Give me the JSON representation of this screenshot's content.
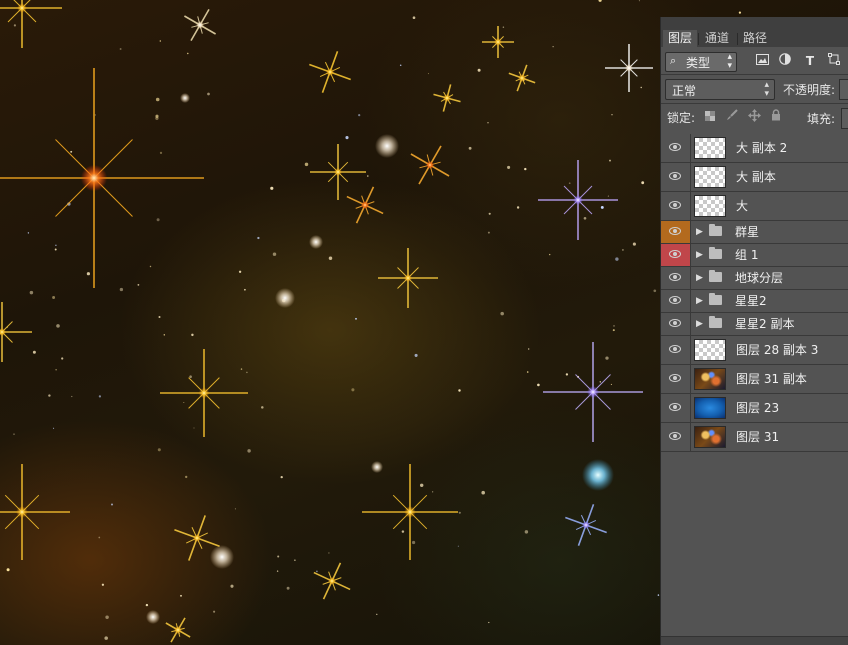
{
  "panel": {
    "tabs": [
      {
        "label": "图层",
        "active": true
      },
      {
        "label": "通道",
        "active": false
      },
      {
        "label": "路径",
        "active": false
      }
    ],
    "filter": {
      "label": "类型",
      "search_icon": "search-icon",
      "arrows_icon": "up-down-arrows-icon"
    },
    "filter_icons": [
      "image-filter-icon",
      "adjustment-filter-icon",
      "text-filter-icon",
      "shape-filter-icon"
    ],
    "text_filter_glyph": "T",
    "blend_mode": "正常",
    "opacity_label": "不透明度:",
    "lock_label": "锁定:",
    "fill_label": "填充:",
    "lock_icons": [
      "lock-transparent-icon",
      "lock-brush-icon",
      "lock-move-icon",
      "lock-all-icon"
    ]
  },
  "layers": [
    {
      "name": "大 副本 2",
      "type": "layer",
      "thumb": "transparent",
      "eye_color": ""
    },
    {
      "name": "大 副本",
      "type": "layer",
      "thumb": "transparent",
      "eye_color": ""
    },
    {
      "name": "大",
      "type": "layer",
      "thumb": "transparent",
      "eye_color": ""
    },
    {
      "name": "群星",
      "type": "group",
      "eye_color": "#b36a1e"
    },
    {
      "name": "组 1",
      "type": "group",
      "eye_color": "#c0464a"
    },
    {
      "name": "地球分层",
      "type": "group",
      "eye_color": ""
    },
    {
      "name": "星星2",
      "type": "group",
      "eye_color": ""
    },
    {
      "name": "星星2 副本",
      "type": "group",
      "eye_color": ""
    },
    {
      "name": "图层 28 副本 3",
      "type": "layer",
      "thumb": "transparent",
      "eye_color": ""
    },
    {
      "name": "图层 31 副本",
      "type": "layer",
      "thumb": "nebula",
      "eye_color": ""
    },
    {
      "name": "图层 23",
      "type": "layer",
      "thumb": "blue",
      "eye_color": ""
    },
    {
      "name": "图层 31",
      "type": "layer",
      "thumb": "nebula",
      "eye_color": ""
    }
  ],
  "colors": {
    "panel_bg": "#535353",
    "tabbar_bg": "#3f3f3f",
    "group_orange": "#b36a1e",
    "group_red": "#c0464a"
  }
}
